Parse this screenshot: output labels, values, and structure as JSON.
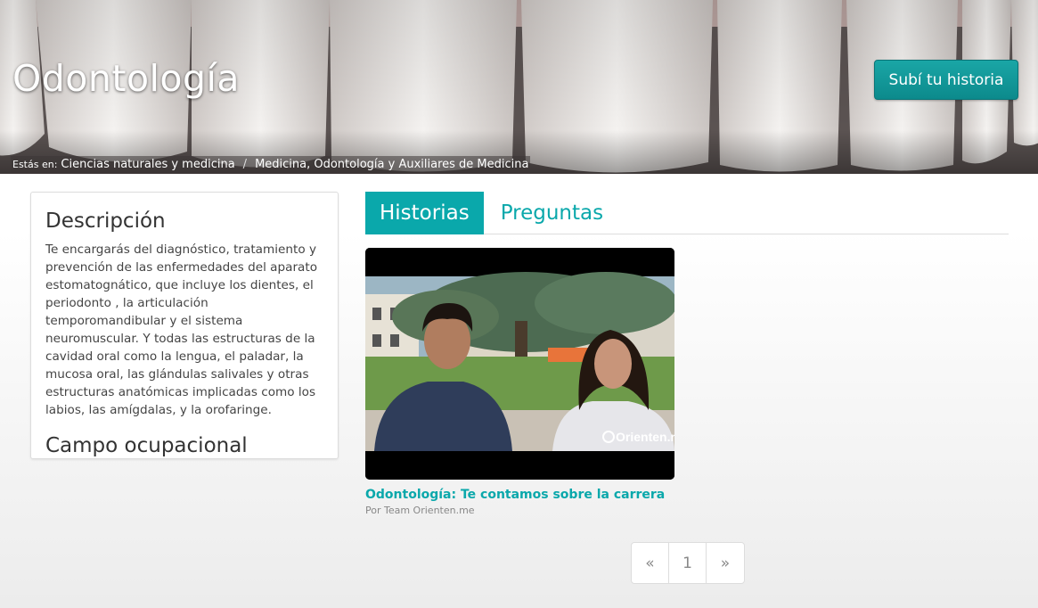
{
  "hero": {
    "title": "Odontología",
    "cta_label": "Subí tu historia"
  },
  "breadcrumb": {
    "prefix": "Estás en:",
    "items": [
      "Ciencias naturales y medicina",
      "Medicina, Odontología y Auxiliares de Medicina"
    ],
    "separator": "/"
  },
  "sidebar": {
    "description_heading": "Descripción",
    "description_text": "Te encargarás del diagnóstico, tratamiento y prevención de las enfermedades del aparato estomatognático, que incluye los dientes, el periodonto , la articulación temporomandibular y el sistema neuromuscular. Y todas las estructuras de la cavidad oral como la lengua, el paladar, la mucosa oral, las glándulas salivales y otras estructuras anatómicas implicadas como los labios, las amígdalas, y la orofaringe.",
    "occupational_heading": "Campo ocupacional"
  },
  "tabs": [
    {
      "label": "Historias",
      "active": true
    },
    {
      "label": "Preguntas",
      "active": false
    }
  ],
  "story": {
    "title": "Odontología: Te contamos sobre la carrera",
    "author": "Por Team Orienten.me",
    "watermark": "Orienten.me"
  },
  "pagination": {
    "prev": "«",
    "current": "1",
    "next": "»"
  },
  "colors": {
    "accent": "#0aa8ab",
    "cta": "#0c8a8c"
  }
}
